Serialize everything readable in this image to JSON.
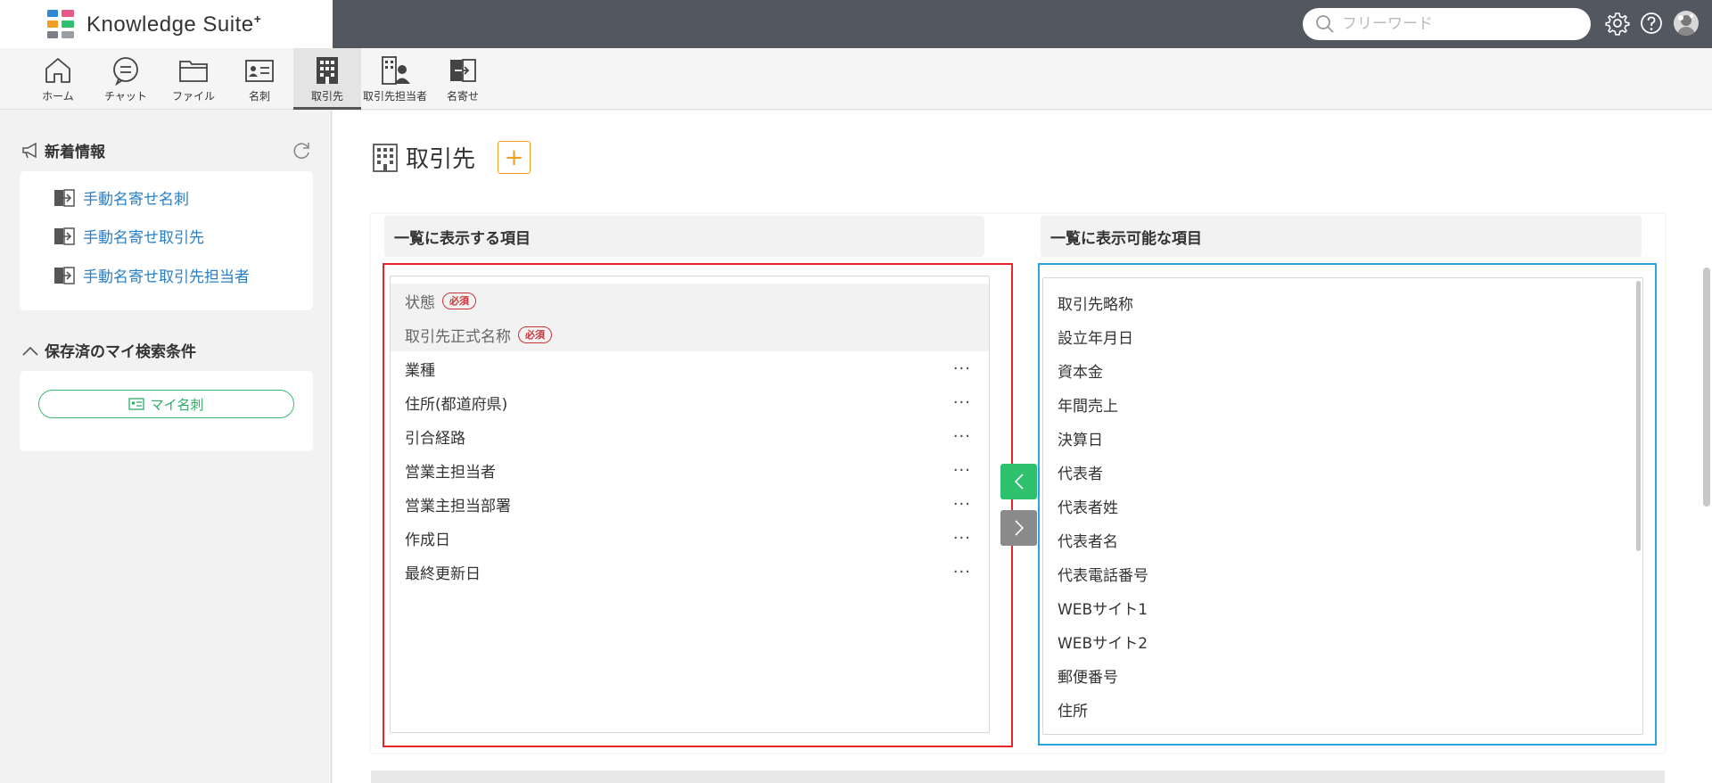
{
  "app": {
    "title": "Knowledge Suite",
    "title_sup": "+"
  },
  "search": {
    "placeholder": "フリーワード",
    "value": ""
  },
  "nav": [
    {
      "label": "ホーム",
      "icon": "home-icon"
    },
    {
      "label": "チャット",
      "icon": "chat-icon"
    },
    {
      "label": "ファイル",
      "icon": "folder-icon"
    },
    {
      "label": "名刺",
      "icon": "business-card-icon"
    },
    {
      "label": "取引先",
      "icon": "building-icon",
      "active": true
    },
    {
      "label": "取引先担当者",
      "icon": "contact-person-icon"
    },
    {
      "label": "名寄せ",
      "icon": "merge-icon"
    }
  ],
  "sidebar": {
    "news_title": "新着情報",
    "news_links": [
      "手動名寄せ名刺",
      "手動名寄せ取引先",
      "手動名寄せ取引先担当者"
    ],
    "saved_title": "保存済のマイ検索条件",
    "my_card_button": "マイ名刺"
  },
  "main": {
    "title": "取引先",
    "add_label": "+",
    "left_header": "一覧に表示する項目",
    "right_header": "一覧に表示可能な項目",
    "required_badge": "必須",
    "required_items": [
      "状態",
      "取引先正式名称"
    ],
    "display_items": [
      "業種",
      "住所(都道府県)",
      "引合経路",
      "営業主担当者",
      "営業主担当部署",
      "作成日",
      "最終更新日"
    ],
    "available_items": [
      "取引先略称",
      "設立年月日",
      "資本金",
      "年間売上",
      "決算日",
      "代表者",
      "代表者姓",
      "代表者名",
      "代表電話番号",
      "WEBサイト1",
      "WEBサイト2",
      "郵便番号",
      "住所"
    ],
    "more_label": "···"
  },
  "colors": {
    "topbar": "#525760",
    "link": "#2a7fc4",
    "accent_green": "#2ec16e",
    "accent_orange": "#f0a020",
    "required_red": "#c8363a",
    "highlight_red": "#e5262a",
    "highlight_blue": "#2da3de"
  }
}
